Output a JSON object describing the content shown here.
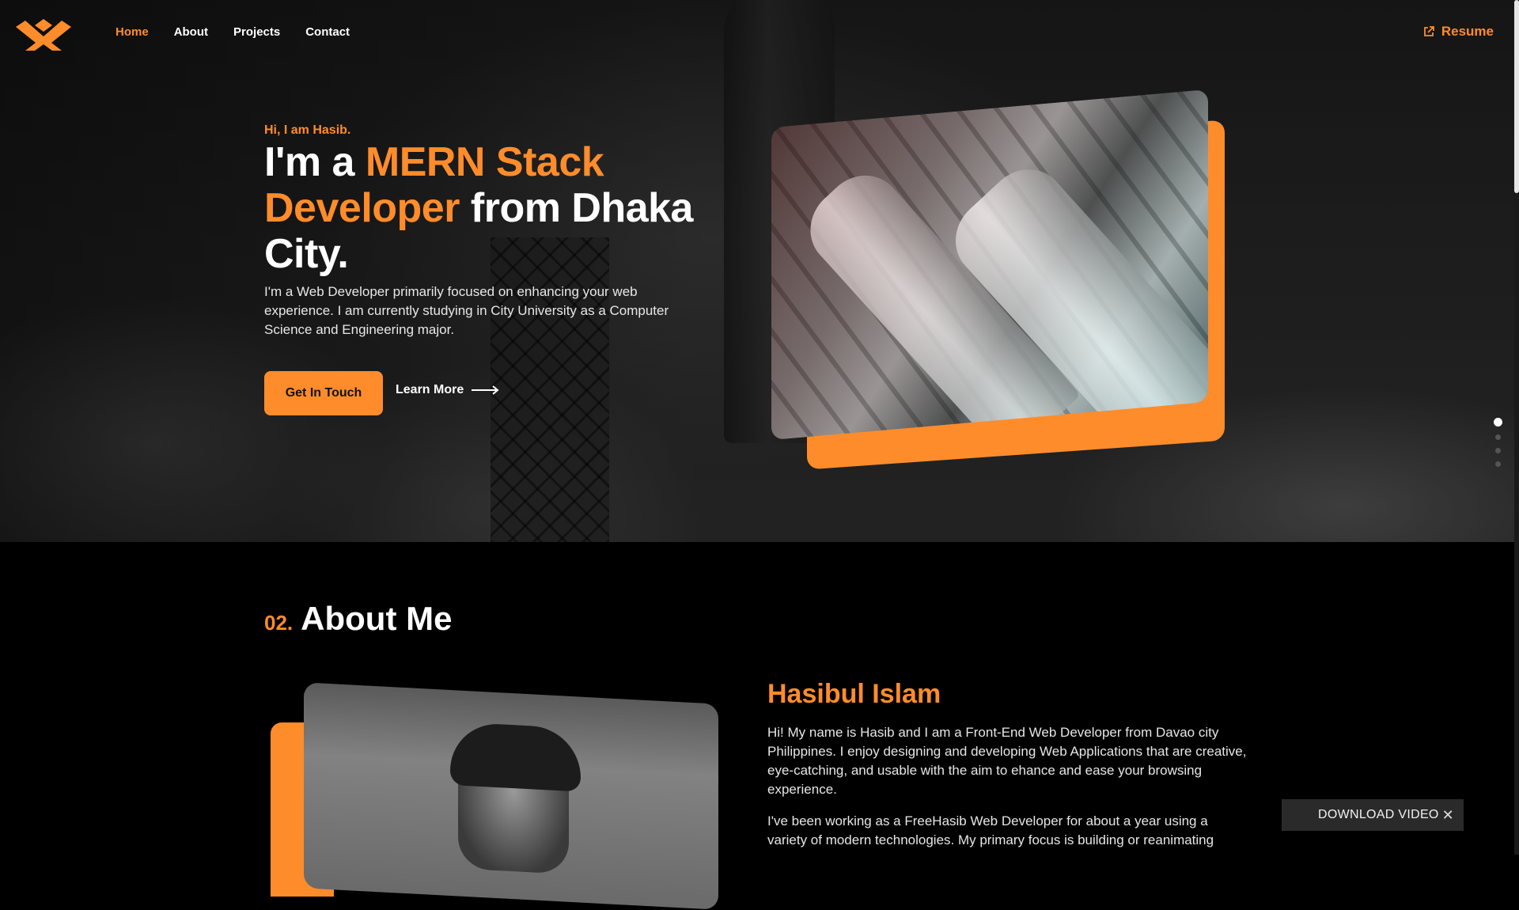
{
  "nav": {
    "items": [
      {
        "label": "Home",
        "active": true
      },
      {
        "label": "About",
        "active": false
      },
      {
        "label": "Projects",
        "active": false
      },
      {
        "label": "Contact",
        "active": false
      }
    ],
    "resume_label": "Resume"
  },
  "hero": {
    "greeting": "Hi, I am Hasib.",
    "headline_part1": "I'm a ",
    "headline_accent": "MERN Stack Developer",
    "headline_part2": " from Dhaka City.",
    "intro": "I'm a Web Developer primarily focused on enhancing your web experience. I am currently studying in City University as a Computer Science and Engineering major.",
    "primary_button": "Get In Touch",
    "secondary_button": "Learn More"
  },
  "side_nav": {
    "count": 4,
    "active_index": 0
  },
  "about": {
    "number": "02.",
    "title": "About Me",
    "name": "Hasibul Islam",
    "paragraph1": "Hi! My name is Hasib and I am a Front-End Web Developer from Davao city Philippines. I enjoy designing and developing Web Applications that are creative, eye-catching, and usable with the aim to ehance and ease your browsing experience.",
    "paragraph2": "I've been working as a FreeHasib Web Developer for about a year using a variety of modern technologies. My primary focus is building or reanimating"
  },
  "popup": {
    "label": "DOWNLOAD VIDEO",
    "close_glyph": "✕"
  },
  "colors": {
    "accent": "#ff8c2b",
    "background": "#000000"
  }
}
